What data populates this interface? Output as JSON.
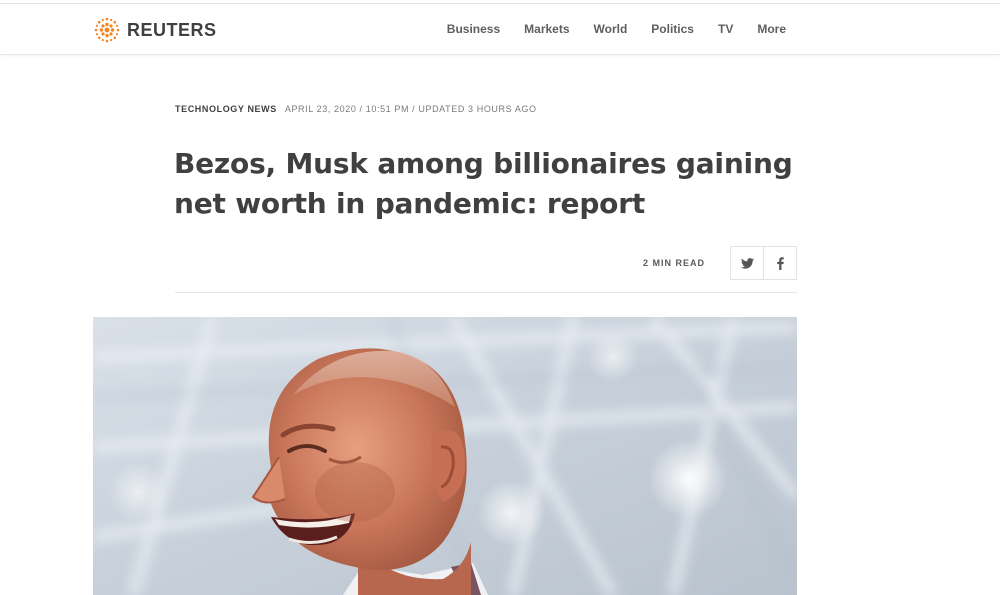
{
  "header": {
    "brand": "REUTERS",
    "brand_color": "#f5831f",
    "nav": [
      "Business",
      "Markets",
      "World",
      "Politics",
      "TV",
      "More"
    ]
  },
  "article": {
    "section": "TECHNOLOGY NEWS",
    "dateline": "APRIL 23, 2020 / 10:51 PM / UPDATED 3 HOURS AGO",
    "headline": "Bezos, Musk among billionaires gaining net worth in pandemic: report",
    "read_time": "2 MIN READ",
    "share": [
      "twitter-icon",
      "facebook-icon"
    ]
  }
}
